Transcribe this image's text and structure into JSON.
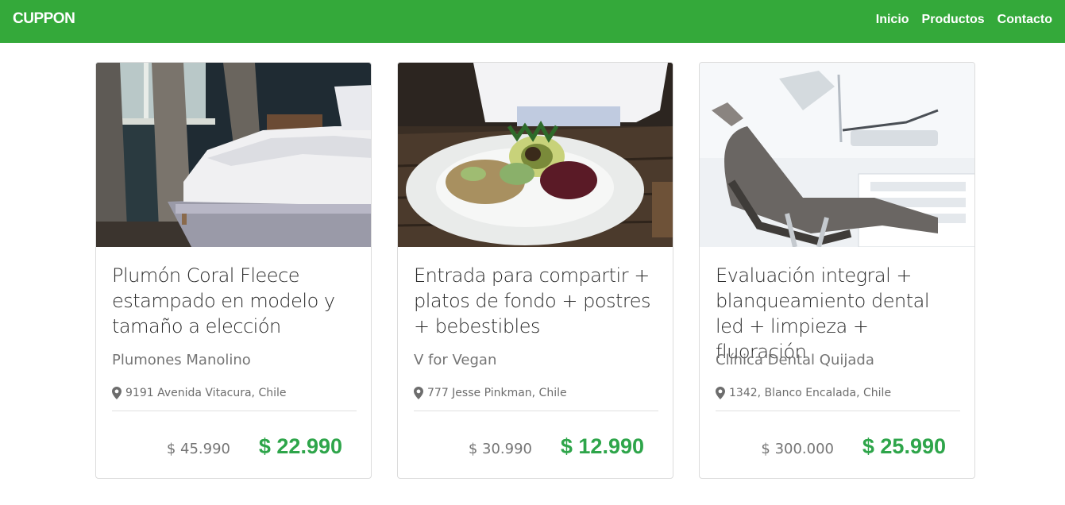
{
  "brand": "CUPPON",
  "nav": {
    "inicio": "Inicio",
    "productos": "Productos",
    "contacto": "Contacto"
  },
  "cards": [
    {
      "title": "Plumón Coral Fleece estampado en modelo y tamaño a elección",
      "merchant": "Plumones Manolino",
      "address": "9191 Avenida Vitacura, Chile",
      "old_price": "$ 45.990",
      "new_price": "$ 22.990",
      "image": "bedroom-photo"
    },
    {
      "title": "Entrada para compartir + platos de fondo + postres + bebestibles",
      "merchant": "V for Vegan",
      "address": "777 Jesse Pinkman, Chile",
      "old_price": "$ 30.990",
      "new_price": "$ 12.990",
      "image": "salad-plate-photo"
    },
    {
      "title": "Evaluación integral + blanqueamiento dental led + limpieza + fluoración",
      "merchant": "Clínica Dental Quijada",
      "address": "1342, Blanco Encalada, Chile",
      "old_price": "$ 300.000",
      "new_price": "$ 25.990",
      "image": "dental-chair-photo"
    }
  ],
  "colors": {
    "navbar": "#34a93a",
    "price": "#2ea54a"
  },
  "icons": {
    "address": "map-marker-icon"
  }
}
